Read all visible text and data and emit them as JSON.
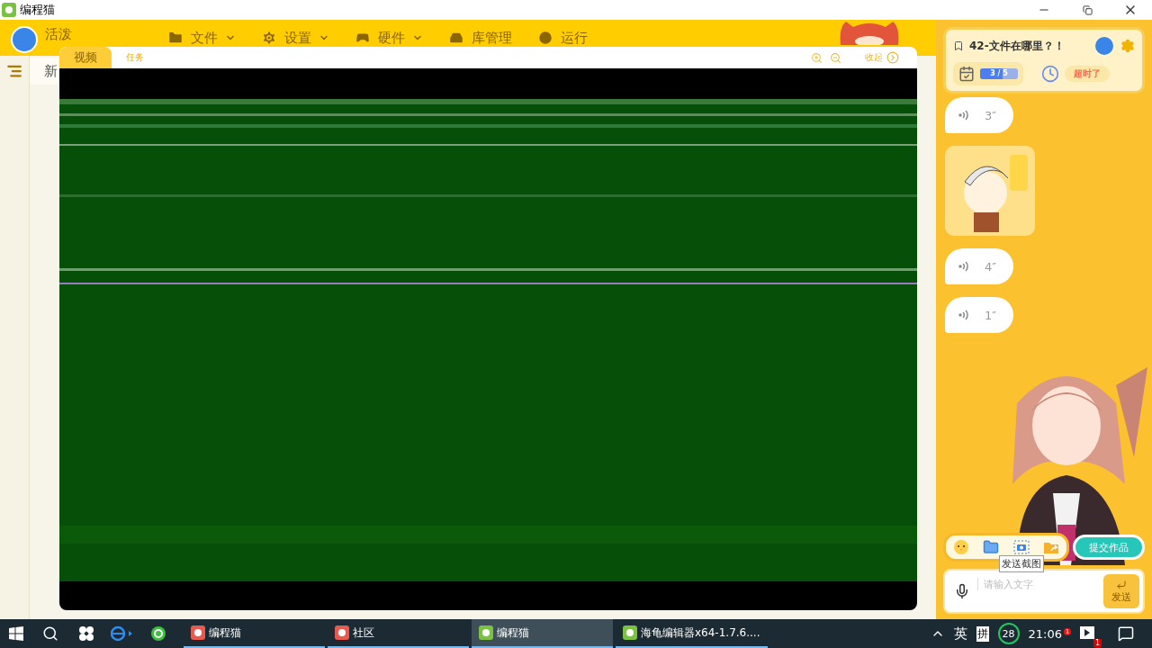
{
  "window": {
    "title": "编程猫"
  },
  "menu": {
    "user": "活泼",
    "items": [
      {
        "label": "文件",
        "dropdown": true
      },
      {
        "label": "设置",
        "dropdown": true
      },
      {
        "label": "硬件",
        "dropdown": true
      },
      {
        "label": "库管理",
        "dropdown": false
      },
      {
        "label": "运行",
        "dropdown": false
      }
    ]
  },
  "editor": {
    "tab": "新"
  },
  "video_panel": {
    "tabs": [
      {
        "label": "视频",
        "selected": true
      },
      {
        "label": "任务",
        "selected": false
      }
    ],
    "collapse": "收起"
  },
  "task": {
    "title": "42-文件在哪里？！",
    "progress": {
      "text": "3 / 5",
      "level": 0.6
    },
    "status": "超时了"
  },
  "messages": [
    {
      "kind": "voice",
      "duration": "3″"
    },
    {
      "kind": "sticker"
    },
    {
      "kind": "voice",
      "duration": "4″"
    },
    {
      "kind": "voice",
      "duration": "1″"
    }
  ],
  "chat": {
    "tooltip": "发送截图",
    "submit": "提交作品",
    "placeholder": "请输入文字",
    "send": "发送"
  },
  "taskbar": {
    "apps": [
      {
        "label": "编程猫",
        "selected": false
      },
      {
        "label": "社区",
        "selected": false
      },
      {
        "label": "编程猫",
        "selected": true
      },
      {
        "label": "海龟编辑器x64-1.7.6....",
        "selected": false
      }
    ],
    "ime": "英",
    "ime_mode": "拼",
    "security_count": "28",
    "time": "21:06",
    "time_badge": "1",
    "notification_count": "1"
  }
}
